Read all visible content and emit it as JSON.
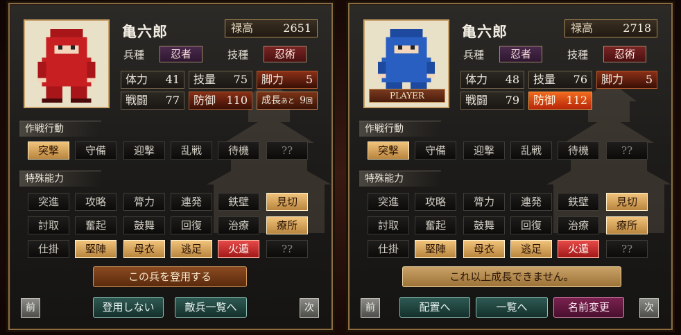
{
  "left": {
    "name": "亀六郎",
    "stipend": {
      "label": "禄高",
      "value": "2651"
    },
    "troop_label": "兵種",
    "troop_value": "忍者",
    "skill_label": "技種",
    "skill_value": "忍術",
    "stats": {
      "hp": {
        "label": "体力",
        "value": "41"
      },
      "tech": {
        "label": "技量",
        "value": "75"
      },
      "leg": {
        "label": "脚力",
        "value": "5"
      },
      "atk": {
        "label": "戦闘",
        "value": "77"
      },
      "def": {
        "label": "防御",
        "value": "110"
      },
      "grow": {
        "label": "成長",
        "small": "あと",
        "value": "9",
        "unit": "回"
      }
    },
    "tactics_title": "作戦行動",
    "tactics": [
      "突撃",
      "守備",
      "迎撃",
      "乱戦",
      "待機",
      "??"
    ],
    "special_title": "特殊能力",
    "special": [
      [
        "突進",
        "攻略",
        "膂力",
        "連発",
        "鉄壁",
        "見切"
      ],
      [
        "討取",
        "奮起",
        "鼓舞",
        "回復",
        "治療",
        "療所"
      ],
      [
        "仕掛",
        "堅陣",
        "母衣",
        "逃足",
        "火遁",
        "??"
      ]
    ],
    "main_action": "この兵を登用する",
    "prev": "前",
    "next": "次",
    "btn_a": "登用しない",
    "btn_b": "敵兵一覧へ"
  },
  "right": {
    "name": "亀六郎",
    "player_tag": "PLAYER",
    "stipend": {
      "label": "禄高",
      "value": "2718"
    },
    "troop_label": "兵種",
    "troop_value": "忍者",
    "skill_label": "技種",
    "skill_value": "忍術",
    "stats": {
      "hp": {
        "label": "体力",
        "value": "48"
      },
      "tech": {
        "label": "技量",
        "value": "76"
      },
      "leg": {
        "label": "脚力",
        "value": "5"
      },
      "atk": {
        "label": "戦闘",
        "value": "79"
      },
      "def": {
        "label": "防御",
        "value": "112"
      }
    },
    "tactics_title": "作戦行動",
    "tactics": [
      "突撃",
      "守備",
      "迎撃",
      "乱戦",
      "待機",
      "??"
    ],
    "special_title": "特殊能力",
    "special": [
      [
        "突進",
        "攻略",
        "膂力",
        "連発",
        "鉄壁",
        "見切"
      ],
      [
        "討取",
        "奮起",
        "鼓舞",
        "回復",
        "治療",
        "療所"
      ],
      [
        "仕掛",
        "堅陣",
        "母衣",
        "逃足",
        "火遁",
        "??"
      ]
    ],
    "main_action": "これ以上成長できません。",
    "prev": "前",
    "next": "次",
    "btn_a": "配置へ",
    "btn_b": "一覧へ",
    "btn_c": "名前変更"
  },
  "colors": {
    "ninja_red": "#c81f22",
    "ninja_blue": "#2a5fc2",
    "active_tan": "#e0ad63",
    "active_red": "#d83232"
  }
}
